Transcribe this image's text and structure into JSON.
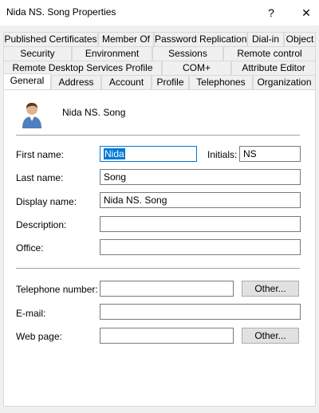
{
  "window": {
    "title": "Nida NS. Song Properties",
    "help_glyph": "?",
    "close_glyph": "✕"
  },
  "tabs": {
    "row1": [
      "Published Certificates",
      "Member Of",
      "Password Replication",
      "Dial-in",
      "Object"
    ],
    "row2": [
      "Security",
      "Environment",
      "Sessions",
      "Remote control"
    ],
    "row3": [
      "Remote Desktop Services Profile",
      "COM+",
      "Attribute Editor"
    ],
    "row4": [
      "General",
      "Address",
      "Account",
      "Profile",
      "Telephones",
      "Organization"
    ],
    "active": "General"
  },
  "general": {
    "display_header": "Nida NS. Song",
    "first_name_label": "First name:",
    "first_name_value": "Nida",
    "initials_label": "Initials:",
    "initials_value": "NS",
    "last_name_label": "Last name:",
    "last_name_value": "Song",
    "display_name_label": "Display name:",
    "display_name_value": "Nida NS. Song",
    "description_label": "Description:",
    "description_value": "",
    "office_label": "Office:",
    "office_value": "",
    "telephone_label": "Telephone number:",
    "telephone_value": "",
    "email_label": "E-mail:",
    "email_value": "",
    "web_page_label": "Web page:",
    "web_page_value": "",
    "other_button_label": "Other..."
  }
}
